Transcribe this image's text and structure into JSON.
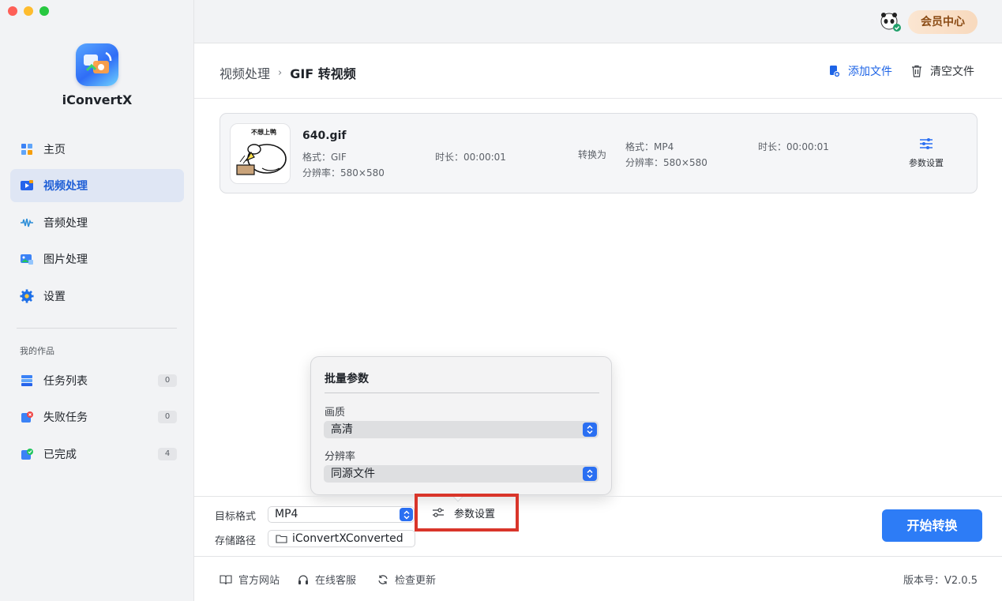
{
  "app": {
    "name": "iConvertX",
    "window_controls": [
      "close",
      "minimize",
      "maximize"
    ]
  },
  "sidebar": {
    "items": [
      {
        "label": "主页",
        "icon": "home-grid-icon"
      },
      {
        "label": "视频处理",
        "icon": "video-icon",
        "active": true
      },
      {
        "label": "音频处理",
        "icon": "audio-wave-icon"
      },
      {
        "label": "图片处理",
        "icon": "image-icon"
      },
      {
        "label": "设置",
        "icon": "gear-icon"
      }
    ],
    "section_label": "我的作品",
    "works": [
      {
        "label": "任务列表",
        "count": "0",
        "icon": "task-list-icon"
      },
      {
        "label": "失败任务",
        "count": "0",
        "icon": "failed-task-icon"
      },
      {
        "label": "已完成",
        "count": "4",
        "icon": "completed-icon"
      }
    ]
  },
  "topbar": {
    "member_label": "会员中心",
    "avatar_icon": "panda-avatar-icon"
  },
  "header": {
    "breadcrumb_parent": "视频处理",
    "breadcrumb_separator": "›",
    "breadcrumb_current": "GIF 转视频",
    "add_file_label": "添加文件",
    "clear_files_label": "清空文件"
  },
  "file": {
    "name": "640.gif",
    "thumb_caption": "不想上鸭",
    "source_format": "格式：GIF",
    "source_resolution": "分辨率：580×580",
    "source_duration": "时长：00:00:01",
    "convert_to_label": "转换为",
    "target_format": "格式：MP4",
    "target_resolution": "分辨率：580×580",
    "target_duration": "时长：00:00:01",
    "param_settings_label": "参数设置"
  },
  "batch_popover": {
    "title": "批量参数",
    "quality_label": "画质",
    "quality_value": "高清",
    "resolution_label": "分辨率",
    "resolution_value": "同源文件"
  },
  "bottom": {
    "target_format_label": "目标格式",
    "target_format_value": "MP4",
    "save_path_label": "存储路径",
    "save_path_value": "iConvertXConverted",
    "param_settings_label": "参数设置",
    "start_label": "开始转换"
  },
  "footer": {
    "website_label": "官方网站",
    "support_label": "在线客服",
    "update_label": "检查更新",
    "version_label": "版本号：V2.0.5"
  },
  "colors": {
    "accent": "#2d7cf6",
    "highlight_border": "#d9352a",
    "member_text": "#8a4b14"
  }
}
